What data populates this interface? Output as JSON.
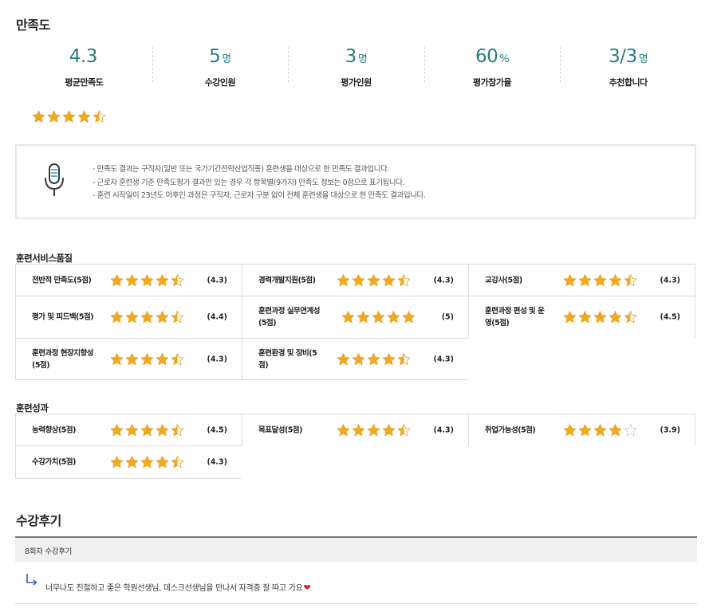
{
  "satisfaction": {
    "title": "만족도",
    "stats": [
      {
        "value": "4.3",
        "unit": "",
        "label": "평균만족도"
      },
      {
        "value": "5",
        "unit": "명",
        "label": "수강인원"
      },
      {
        "value": "3",
        "unit": "명",
        "label": "평가인원"
      },
      {
        "value": "60",
        "unit": "%",
        "label": "평가참가율"
      },
      {
        "value": "3/3",
        "unit": "명",
        "label": "추천합니다"
      }
    ],
    "overall_rating": 4.3,
    "notice": [
      "만족도 결과는 구직자(일반 또는 국가기간전략산업직종) 훈련생을 대상으로 한 만족도 결과입니다.",
      "근로자 훈련생 기준 만족도평가 결과만 있는 경우 각 항목별(9가지) 만족도 정보는 0점으로 표기됩니다.",
      "훈련 시작일이 23년도 이후인 과정은 구직자, 근로자 구분 없이 전체 훈련생을 대상으로 한 만족도 결과입니다."
    ]
  },
  "service_quality": {
    "title": "훈련서비스품질",
    "items": [
      {
        "label": "전반적 만족도(5점)",
        "rating": 4.3,
        "score": "(4.3)"
      },
      {
        "label": "경력개발지원(5점)",
        "rating": 4.3,
        "score": "(4.3)"
      },
      {
        "label": "교강사(5점)",
        "rating": 4.3,
        "score": "(4.3)"
      },
      {
        "label": "평가 및 피드백(5점)",
        "rating": 4.4,
        "score": "(4.4)"
      },
      {
        "label": "훈련과정 실무연계성(5점)",
        "rating": 5,
        "score": "(5)"
      },
      {
        "label": "훈련과정 편성 및 운영(5점)",
        "rating": 4.5,
        "score": "(4.5)"
      },
      {
        "label": "훈련과정 현장지향성(5점)",
        "rating": 4.3,
        "score": "(4.3)"
      },
      {
        "label": "훈련환경 및 장비(5점)",
        "rating": 4.3,
        "score": "(4.3)"
      }
    ]
  },
  "outcomes": {
    "title": "훈련성과",
    "items": [
      {
        "label": "능력향상(5점)",
        "rating": 4.5,
        "score": "(4.5)"
      },
      {
        "label": "목표달성(5점)",
        "rating": 4.3,
        "score": "(4.3)"
      },
      {
        "label": "취업가능성(5점)",
        "rating": 3.9,
        "score": "(3.9)"
      },
      {
        "label": "수강가치(5점)",
        "rating": 4.3,
        "score": "(4.3)"
      }
    ]
  },
  "reviews": {
    "title": "수강후기",
    "round_label": "8회차 수강후기",
    "items": [
      {
        "text": "너무나도 친절하고 좋은 학원선생님, 데스크선생님을 만나서 자격증 잘 따고 가요",
        "icon": "heart-icon"
      }
    ]
  },
  "colors": {
    "accent": "#2a7d7d",
    "star_fill": "#f2a91c",
    "star_empty": "#d8d8d8",
    "heart": "#d6212a",
    "border": "#dcdcdc"
  }
}
